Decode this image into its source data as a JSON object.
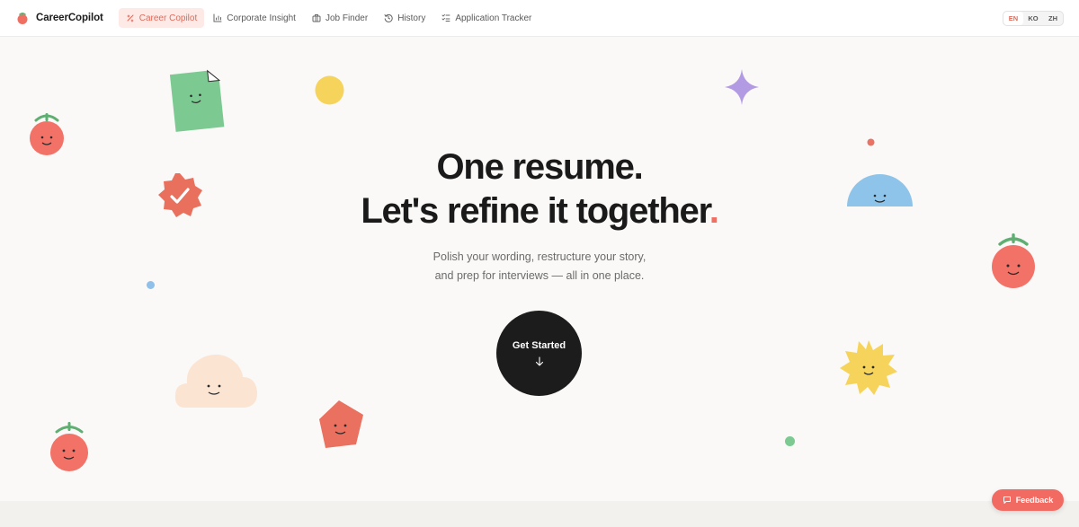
{
  "brand": {
    "name": "CareerCopilot",
    "logo_icon": "tomato-logo-icon"
  },
  "nav": {
    "items": [
      {
        "label": "Career Copilot",
        "icon": "sparkle-icon",
        "active": true
      },
      {
        "label": "Corporate Insight",
        "icon": "bar-chart-icon",
        "active": false
      },
      {
        "label": "Job Finder",
        "icon": "briefcase-icon",
        "active": false
      },
      {
        "label": "History",
        "icon": "history-icon",
        "active": false
      },
      {
        "label": "Application Tracker",
        "icon": "list-check-icon",
        "active": false
      }
    ]
  },
  "language": {
    "options": [
      "EN",
      "KO",
      "ZH"
    ],
    "selected": "EN"
  },
  "hero": {
    "title_line1": "One resume.",
    "title_line2": "Let's refine it together",
    "title_punct": ".",
    "subtitle_line1": "Polish your wording, restructure your story,",
    "subtitle_line2": "and prep for interviews — all in one place.",
    "cta_label": "Get Started"
  },
  "feedback": {
    "label": "Feedback"
  },
  "colors": {
    "accent": "#f26b62",
    "active_nav_bg": "#fde9e6",
    "background": "#faf9f7",
    "cta_bg": "#1c1c1c"
  }
}
